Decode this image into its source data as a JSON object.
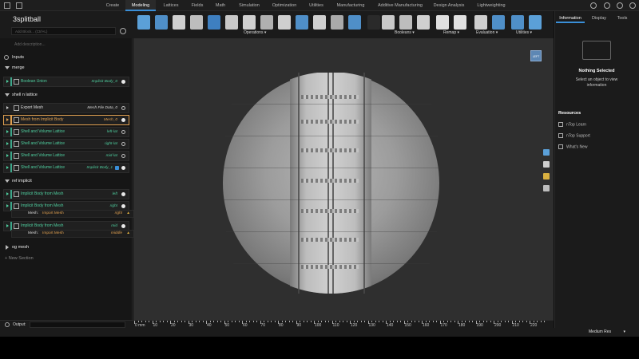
{
  "nav": {
    "tabs": [
      "Create",
      "Modeling",
      "Lattices",
      "Fields",
      "Math",
      "Simulation",
      "Optimization",
      "Utilities",
      "Manufacturing",
      "Additive Manufacturing",
      "Design Analysis",
      "Lightweighting"
    ],
    "active": "Modeling"
  },
  "doc": {
    "title": "3splitball",
    "add_block_placeholder": "Add Block... (Ctrl+L)",
    "add_description": "Add description..."
  },
  "ribbon": {
    "groups": [
      "Operations",
      "Booleans",
      "Remap",
      "Evaluation",
      "Utilities"
    ]
  },
  "notebook": {
    "inputs_label": "Inputs",
    "sections": [
      {
        "name": "merge",
        "blocks": [
          {
            "label": "Boolean Union",
            "type": "Implicit Body_0",
            "status": "filled"
          }
        ]
      },
      {
        "name": "shell n lattice",
        "blocks": [
          {
            "label": "Export Mesh",
            "type": "Mesh File Data_0",
            "status": "filled"
          },
          {
            "label": "Mesh from Implicit Body",
            "type": "Mesh_0",
            "status": "filled"
          },
          {
            "label": "Shell and Volume Lattice",
            "type": "left-lat",
            "status": "outline"
          },
          {
            "label": "Shell and Volume Lattice",
            "type": "right-lat",
            "status": "outline"
          },
          {
            "label": "Shell and Volume Lattice",
            "type": "mid-lat",
            "status": "outline"
          },
          {
            "label": "Shell and Volume Lattice",
            "type": "Implicit Body_1",
            "status": "filled"
          }
        ]
      },
      {
        "name": "ref implicit",
        "blocks": [
          {
            "label": "Implicit Body from Mesh",
            "type": "left",
            "status": "filled"
          },
          {
            "label": "Implicit Body from Mesh",
            "type": "right",
            "status": "filled",
            "sub": {
              "label": "Mesh:",
              "value": "Import Mesh",
              "type": "right"
            }
          },
          {
            "label": "Implicit Body from Mesh",
            "type": "mid",
            "status": "filled",
            "sub": {
              "label": "Mesh:",
              "value": "Import Mesh",
              "type": "middle"
            }
          }
        ]
      },
      {
        "name": "og mesh",
        "blocks": []
      }
    ],
    "new_section": "New Section",
    "output_label": "Output:"
  },
  "right_panel": {
    "tabs": [
      "Information",
      "Display",
      "Tools"
    ],
    "active": "Information",
    "nothing_title": "Nothing Selected",
    "nothing_sub": "Select an object to view information",
    "resources_title": "Resources",
    "links": [
      "nTop Learn",
      "nTop Support",
      "What's New"
    ]
  },
  "ruler": {
    "labels": [
      "0 mm",
      "10",
      "20",
      "30",
      "40",
      "50",
      "60",
      "70",
      "80",
      "90",
      "100",
      "110",
      "120",
      "130",
      "140",
      "150",
      "160",
      "170",
      "180",
      "190",
      "200",
      "210",
      "220"
    ]
  },
  "status": {
    "resolution": "Medium Res"
  },
  "viewcube_label": "LEFT",
  "colors": {
    "accent": "#3a8fd8",
    "block_text": "#4fd0a0",
    "warn": "#e0b040"
  }
}
